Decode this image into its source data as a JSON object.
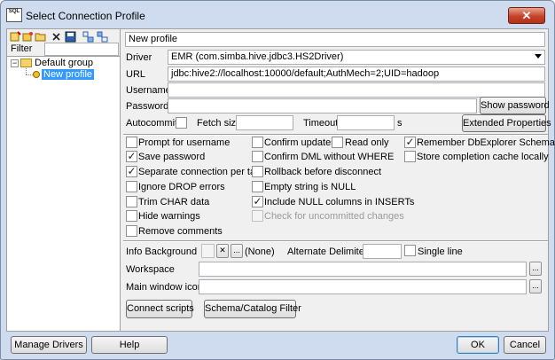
{
  "window": {
    "title": "Select Connection Profile",
    "app_icon_text": "SQL",
    "close_glyph": "✕"
  },
  "left_panel": {
    "toolbar_icons": [
      "new-profile-icon",
      "copy-profile-icon",
      "new-folder-icon",
      "delete-icon",
      "save-icon",
      "expand-all-icon",
      "collapse-all-icon"
    ],
    "filter_label": "Filter",
    "filter_value": "",
    "tree": {
      "group_label": "Default group",
      "expand_glyph": "−",
      "profile_label": "New profile"
    }
  },
  "profile": {
    "name": "New profile",
    "driver_label": "Driver",
    "driver_value": "EMR (com.simba.hive.jdbc3.HS2Driver)",
    "url_label": "URL",
    "url_value": "jdbc:hive2://localhost:10000/default;AuthMech=2;UID=hadoop",
    "username_label": "Username",
    "username_value": "",
    "password_label": "Password",
    "password_value": "",
    "show_password_label": "Show password",
    "autocommit_label": "Autocommit",
    "autocommit_checked": false,
    "fetch_size_label": "Fetch size",
    "fetch_size_value": "",
    "timeout_label": "Timeout",
    "timeout_value": "",
    "timeout_unit": "s",
    "extended_properties_label": "Extended Properties"
  },
  "options": {
    "prompt_username": {
      "label": "Prompt for username",
      "checked": false
    },
    "save_password": {
      "label": "Save password",
      "checked": true
    },
    "separate_connection": {
      "label": "Separate connection per tab",
      "checked": true
    },
    "ignore_drop_errors": {
      "label": "Ignore DROP errors",
      "checked": false
    },
    "trim_char_data": {
      "label": "Trim CHAR data",
      "checked": false
    },
    "hide_warnings": {
      "label": "Hide warnings",
      "checked": false
    },
    "remove_comments": {
      "label": "Remove comments",
      "checked": false
    },
    "confirm_updates": {
      "label": "Confirm updates",
      "checked": false
    },
    "read_only": {
      "label": "Read only",
      "checked": false
    },
    "confirm_dml": {
      "label": "Confirm DML without WHERE",
      "checked": false
    },
    "rollback_disconnect": {
      "label": "Rollback before disconnect",
      "checked": false
    },
    "empty_string_null": {
      "label": "Empty string is NULL",
      "checked": false
    },
    "include_null_columns": {
      "label": "Include NULL columns in INSERTs",
      "checked": true
    },
    "check_uncommitted": {
      "label": "Check for uncommitted changes",
      "checked": false,
      "disabled": true
    },
    "remember_dbexplorer": {
      "label": "Remember DbExplorer Schema",
      "checked": true
    },
    "store_completion_cache": {
      "label": "Store completion cache locally",
      "checked": false
    }
  },
  "extras": {
    "info_background_label": "Info Background",
    "clear_glyph": "✕",
    "ellipsis": "...",
    "info_background_value": "(None)",
    "alternate_delimiter_label": "Alternate Delimiter",
    "alternate_delimiter_value": "",
    "single_line_label": "Single line",
    "single_line_checked": false,
    "workspace_label": "Workspace",
    "workspace_value": "",
    "main_window_icon_label": "Main window icon",
    "main_window_icon_value": "",
    "connect_scripts_label": "Connect scripts",
    "schema_catalog_filter_label": "Schema/Catalog Filter"
  },
  "bottom": {
    "manage_drivers_label": "Manage Drivers",
    "manage_drivers_mnemonic": "D",
    "help_label": "Help",
    "ok_label": "OK",
    "cancel_label": "Cancel"
  }
}
